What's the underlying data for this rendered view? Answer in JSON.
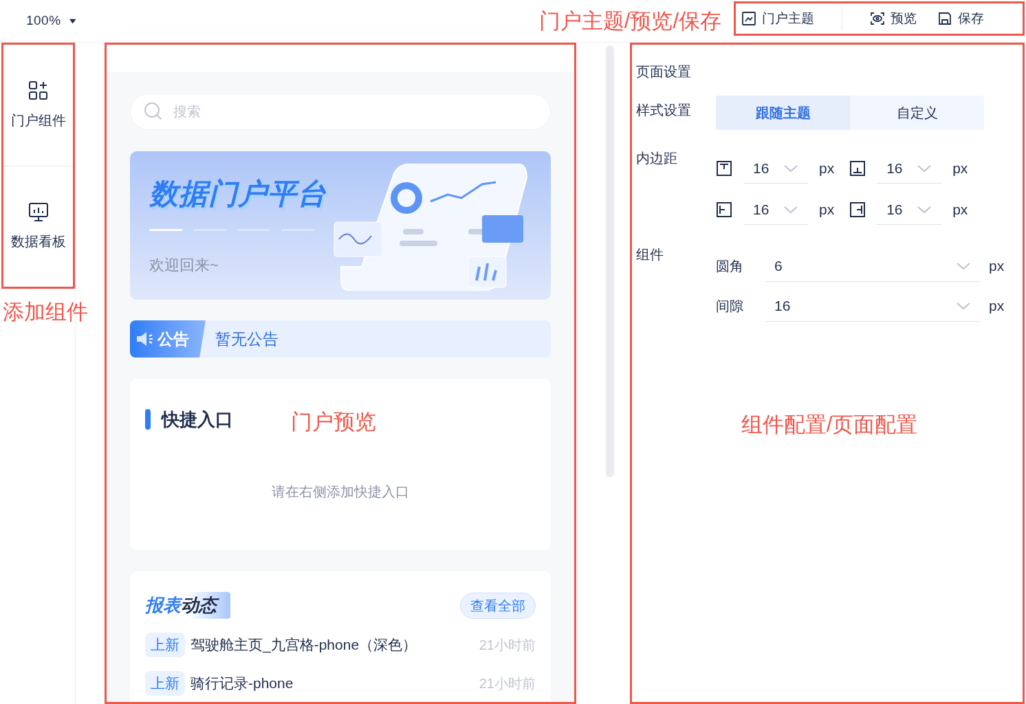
{
  "header": {
    "zoom": "100%",
    "annotation": "门户主题/预览/保存",
    "actions": [
      {
        "kind": "theme",
        "label": "门户主题"
      },
      {
        "kind": "preview",
        "label": "预览"
      },
      {
        "kind": "save",
        "label": "保存"
      }
    ]
  },
  "sidebar": {
    "items": [
      {
        "kind": "grid",
        "label": "门户组件"
      },
      {
        "kind": "chart",
        "label": "数据看板"
      }
    ],
    "annotation": "添加组件"
  },
  "preview": {
    "search": {
      "placeholder": "搜索"
    },
    "banner": {
      "title": "数据门户平台",
      "subtitle": "欢迎回来~",
      "slides": [
        {
          "selected": true
        },
        {
          "selected": false
        },
        {
          "selected": false
        },
        {
          "selected": false
        }
      ]
    },
    "notice": {
      "label": "公告",
      "text": "暂无公告"
    },
    "quick_entry": {
      "title": "快捷入口",
      "empty": "请在右侧添加快捷入口"
    },
    "annotation": "门户预览",
    "reports": {
      "title_highlight": "报表",
      "title_rest": "动态",
      "view_all": "查看全部",
      "items": [
        {
          "tag": "上新",
          "name": "驾驶舱主页_九宫格-phone（深色）",
          "time": "21小时前"
        },
        {
          "tag": "上新",
          "name": "骑行记录-phone",
          "time": "21小时前"
        }
      ]
    }
  },
  "settings": {
    "title": "页面设置",
    "style": {
      "label": "样式设置",
      "options": [
        {
          "label": "跟随主题",
          "selected": true
        },
        {
          "label": "自定义",
          "selected": false
        }
      ]
    },
    "padding": {
      "label": "内边距",
      "fields": [
        {
          "kind": "top",
          "value": "16",
          "unit": "px"
        },
        {
          "kind": "bottom",
          "value": "16",
          "unit": "px"
        },
        {
          "kind": "left",
          "value": "16",
          "unit": "px"
        },
        {
          "kind": "right",
          "value": "16",
          "unit": "px"
        }
      ]
    },
    "component": {
      "label": "组件",
      "fields": [
        {
          "label": "圆角",
          "value": "6",
          "unit": "px"
        },
        {
          "label": "间隙",
          "value": "16",
          "unit": "px"
        }
      ]
    },
    "annotation": "组件配置/页面配置"
  }
}
